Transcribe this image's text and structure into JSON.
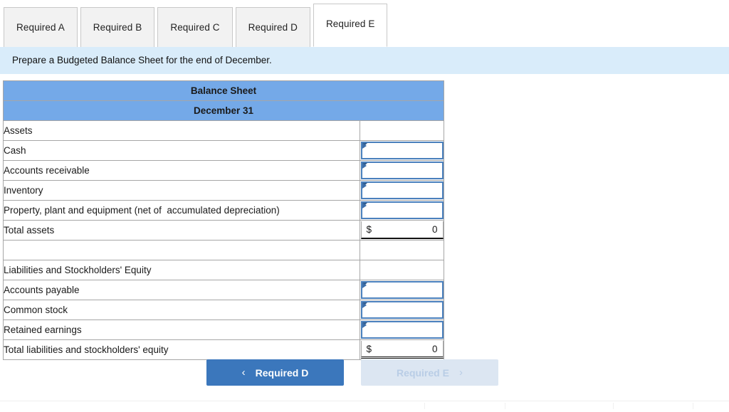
{
  "tabs": [
    {
      "label": "Required A",
      "active": false
    },
    {
      "label": "Required B",
      "active": false
    },
    {
      "label": "Required C",
      "active": false
    },
    {
      "label": "Required D",
      "active": false
    },
    {
      "label": "Required E",
      "active": true
    }
  ],
  "instruction": {
    "text": "Prepare a Budgeted Balance Sheet for the end of December."
  },
  "balance_sheet": {
    "title": "Balance Sheet",
    "subtitle": "December 31",
    "rows": [
      {
        "label": "Assets",
        "type": "section"
      },
      {
        "label": "Cash",
        "type": "input"
      },
      {
        "label": "Accounts receivable",
        "type": "input"
      },
      {
        "label": "Inventory",
        "type": "input"
      },
      {
        "label": "Property, plant and equipment (net of  accumulated depreciation)",
        "type": "input"
      },
      {
        "label": "Total assets",
        "type": "total",
        "currency": "$",
        "value": "0"
      },
      {
        "label": "",
        "type": "spacer"
      },
      {
        "label": "Liabilities and Stockholders' Equity",
        "type": "section"
      },
      {
        "label": "Accounts payable",
        "type": "input"
      },
      {
        "label": "Common stock",
        "type": "input"
      },
      {
        "label": "Retained earnings",
        "type": "input"
      },
      {
        "label": "Total liabilities and stockholders' equity",
        "type": "grandtotal",
        "currency": "$",
        "value": "0"
      }
    ]
  },
  "navigation": {
    "prev_label": "Required D",
    "prev_icon": "chevron-left-icon",
    "prev_chevron": "‹",
    "next_label": "Required E",
    "next_icon": "chevron-right-icon",
    "next_chevron": "›",
    "next_disabled": true
  },
  "colors": {
    "tab_active_bg": "#ffffff",
    "tab_inactive_bg": "#f2f2f2",
    "instruction_bg": "#d9ecfa",
    "table_header_bg": "#74a9e8",
    "input_border": "#4a80bd",
    "button_primary": "#3b77bc",
    "button_disabled": "#dce6f2",
    "button_disabled_text": "#b9cde6"
  }
}
